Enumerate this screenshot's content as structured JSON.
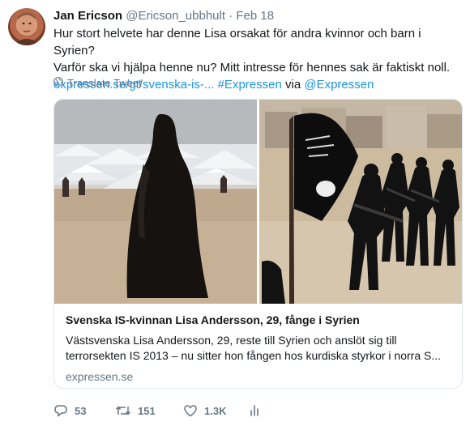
{
  "tweet": {
    "author_name": "Jan Ericson",
    "handle": "@Ericson_ubbhult",
    "separator": "·",
    "date": "Feb 18",
    "text_line1": "Hur stort helvete har denne Lisa orsakat för andra kvinnor och barn i Syrien?",
    "text_line2": "Varför ska vi hjälpa henne nu? Mitt intresse för hennes sak är faktiskt noll.",
    "link_url": "expressen.se/gt/svenska-is-...",
    "hashtag": "#Expressen",
    "via_text": "via",
    "mention": "@Expressen",
    "translate_label": "Translate Tweet"
  },
  "card": {
    "title": "Svenska IS-kvinnan Lisa Andersson, 29, fånge i Syrien",
    "description_line1": "Västsvenska Lisa Andersson, 29, reste till Syrien och anslöt sig till",
    "description_line2": "terrorsekten IS 2013 – nu sitter hon fången hos kurdiska styrkor i norra S...",
    "domain": "expressen.se"
  },
  "actions": {
    "reply_count": "53",
    "retweet_count": "151",
    "like_count": "1.3K"
  },
  "colors": {
    "link": "#1b95e0",
    "muted": "#657786",
    "text": "#14171a",
    "border": "#e1e8ed"
  },
  "icons": [
    "globe-icon",
    "reply-icon",
    "retweet-icon",
    "like-icon",
    "analytics-icon"
  ]
}
